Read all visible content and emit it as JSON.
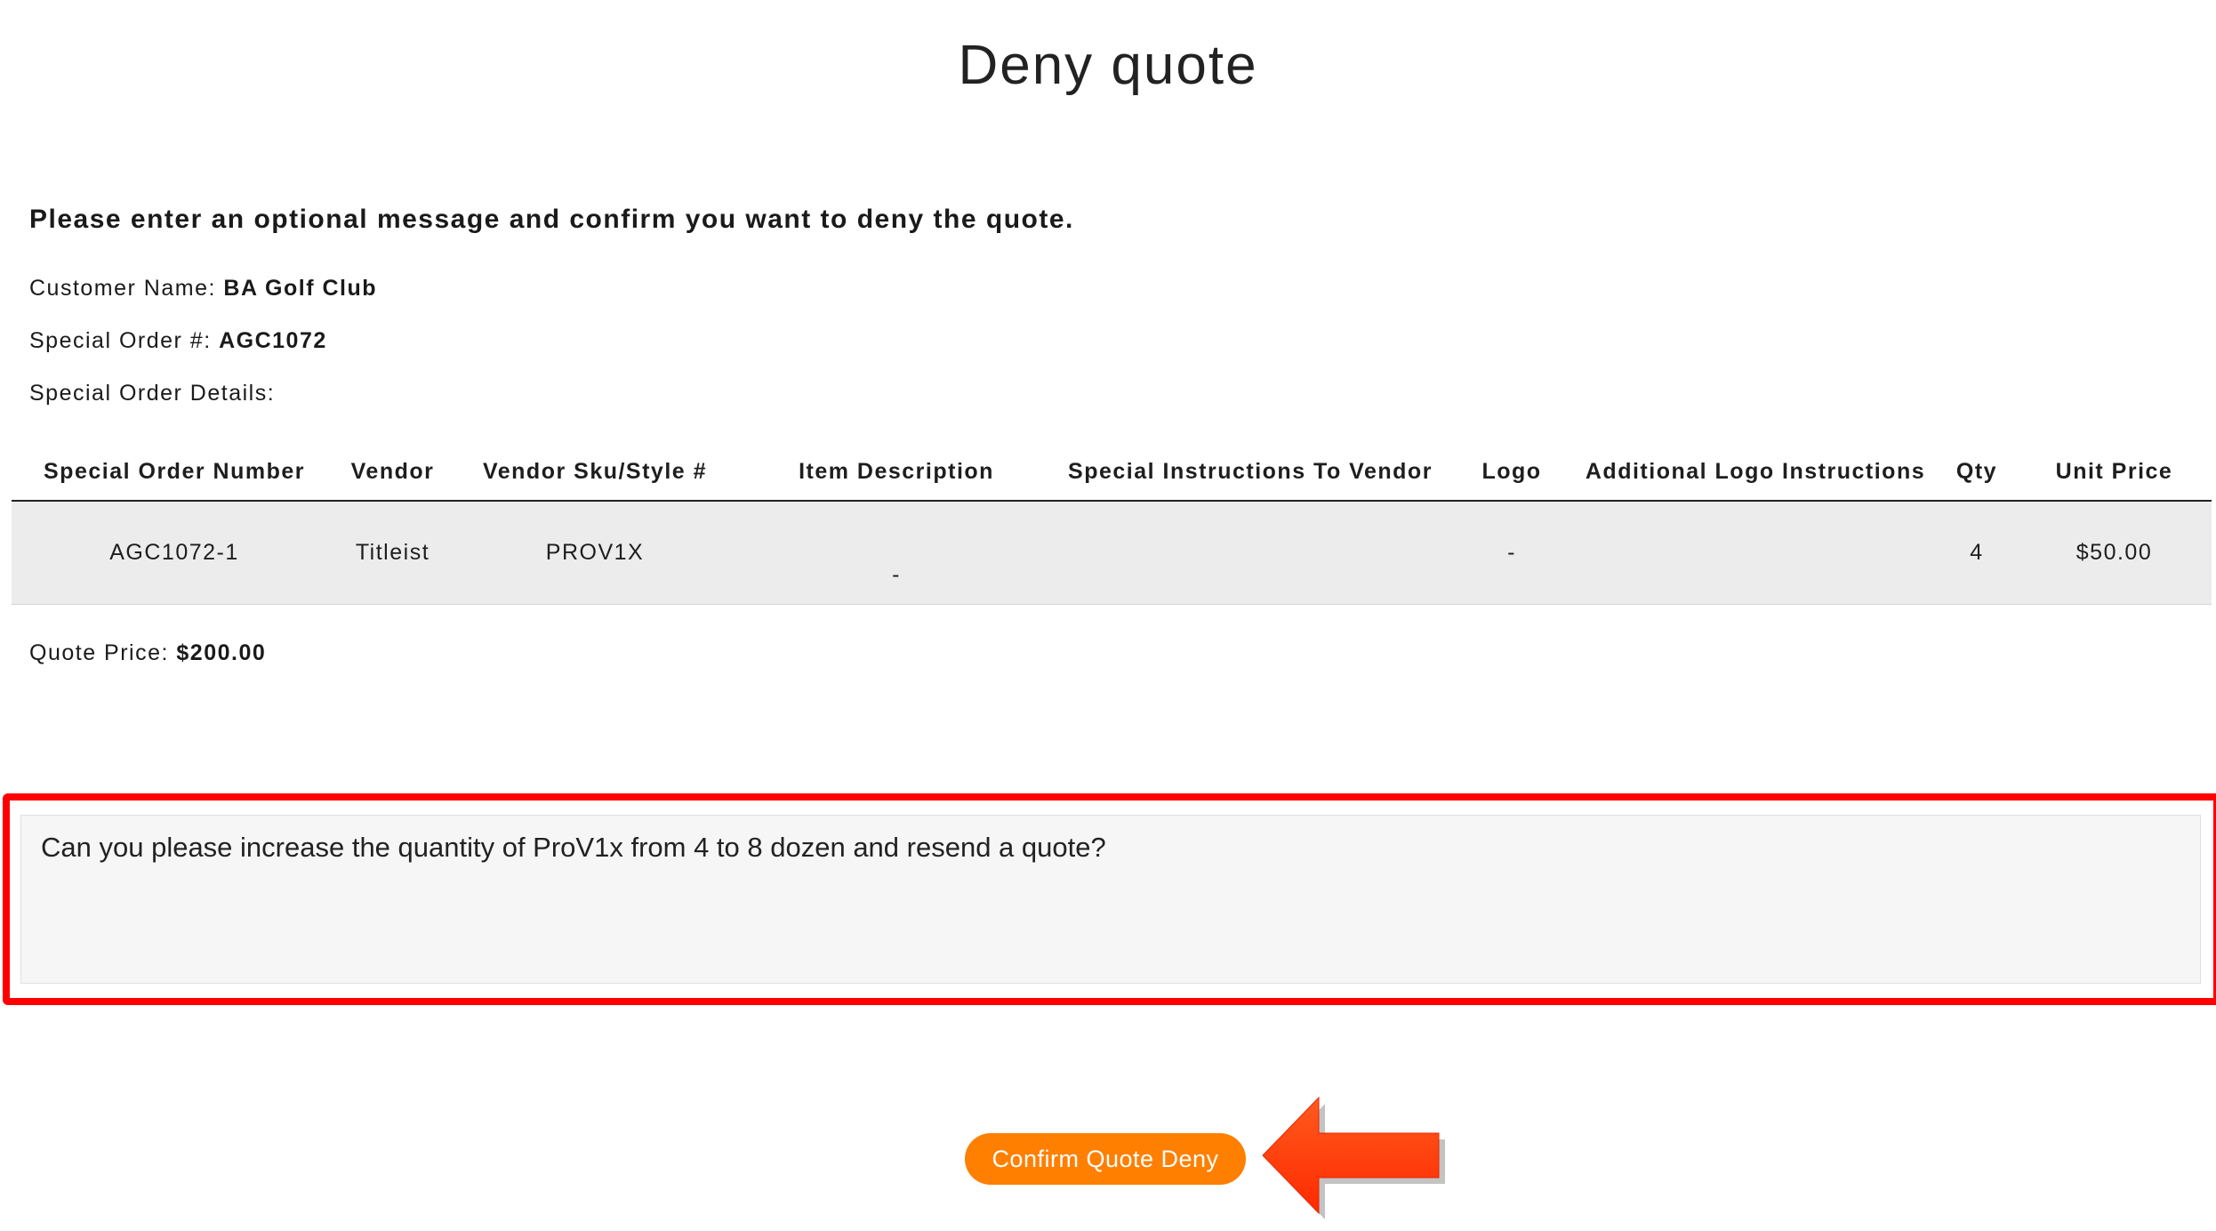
{
  "page": {
    "title": "Deny quote",
    "instructions": "Please enter an optional message and confirm you want to deny the quote."
  },
  "customer": {
    "label": "Customer Name:",
    "value": "BA Golf Club"
  },
  "special_order": {
    "label": "Special Order #:",
    "value": "AGC1072"
  },
  "details": {
    "label": "Special Order Details:"
  },
  "table": {
    "headers": [
      "Special Order Number",
      "Vendor",
      "Vendor Sku/Style #",
      "Item Description",
      "Special Instructions To Vendor",
      "Logo",
      "Additional Logo Instructions",
      "Qty",
      "Unit Price"
    ],
    "rows": [
      {
        "order_number": "AGC1072-1",
        "vendor": "Titleist",
        "sku": "PROV1X",
        "description": "-",
        "special_instructions": "",
        "logo": "-",
        "logo_instructions": "",
        "qty": "4",
        "unit_price": "$50.00"
      }
    ]
  },
  "quote": {
    "label": "Quote Price:",
    "value": "$200.00"
  },
  "message": {
    "value": "Can you please increase the quantity of ProV1x from 4 to 8 dozen and resend a quote?"
  },
  "actions": {
    "confirm_label": "Confirm Quote Deny"
  },
  "colors": {
    "accent": "#ff7f00",
    "highlight_frame": "#ff0000",
    "annotation_arrow": "#ff3300"
  },
  "icons": {
    "annotation": "arrow-left-icon"
  }
}
